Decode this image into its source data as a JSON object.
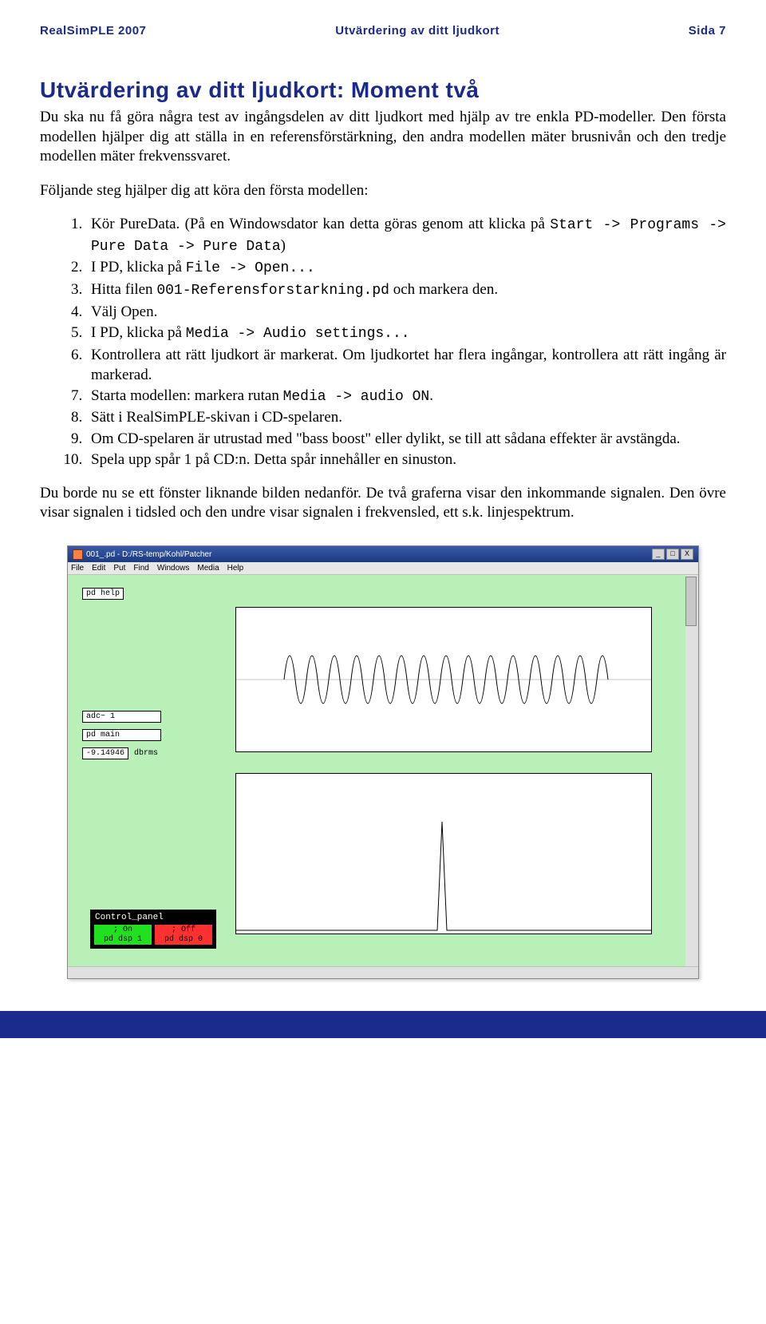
{
  "header": {
    "left": "RealSimPLE 2007",
    "center": "Utvärdering av ditt ljudkort",
    "right": "Sida 7"
  },
  "title": "Utvärdering av ditt ljudkort: Moment två",
  "intro1": "Du ska nu få göra några test av ingångsdelen av ditt ljudkort med hjälp av tre enkla PD-modeller. Den första modellen hjälper dig att ställa in en referensförstärkning, den andra modellen mäter brusnivån och den tredje modellen mäter frekvenssvaret.",
  "intro2": "Följande steg hjälper dig att köra den första modellen:",
  "steps": {
    "s1a": "Kör PureData. (På en Windowsdator kan detta göras genom att klicka på ",
    "s1b": "Start -> Programs -> Pure Data -> Pure Data",
    "s1c": ")",
    "s2a": "I PD, klicka på ",
    "s2b": "File -> Open...",
    "s3a": "Hitta filen ",
    "s3b": "001-Referensforstarkning.pd",
    "s3c": " och markera den.",
    "s4": "Välj Open.",
    "s5a": "I PD, klicka på ",
    "s5b": "Media -> Audio settings...",
    "s6": "Kontrollera att rätt ljudkort är markerat. Om ljudkortet har flera ingångar, kontrollera att rätt ingång är markerad.",
    "s7a": "Starta modellen: markera rutan ",
    "s7b": "Media -> audio ON",
    "s7c": ".",
    "s8": "Sätt i RealSimPLE-skivan i CD-spelaren.",
    "s9": "Om CD-spelaren är utrustad med \"bass boost\" eller dylikt, se till att sådana effekter är avstängda.",
    "s10": "Spela upp spår 1 på CD:n. Detta spår innehåller en sinuston."
  },
  "after": "Du borde nu se ett fönster liknande bilden nedanför. De två graferna visar den inkommande signalen. Den övre visar signalen i tidsled och den undre visar signalen i frekvensled, ett s.k. linjespektrum.",
  "pd": {
    "title": "001_.pd - D:/RS-temp/Kohl/Patcher",
    "menus": [
      "File",
      "Edit",
      "Put",
      "Find",
      "Windows",
      "Media",
      "Help"
    ],
    "box_help": "pd help",
    "box_main": "pd main",
    "box_adc": "adc~ 1",
    "box_val": "-9.14946",
    "box_dbrms": "dbrms",
    "control_title": "Control_panel",
    "on_line1": "; On",
    "on_line2": "pd dsp 1",
    "off_line1": "; Off",
    "off_line2": "pd dsp 0",
    "win_min": "_",
    "win_max": "□",
    "win_close": "X"
  }
}
